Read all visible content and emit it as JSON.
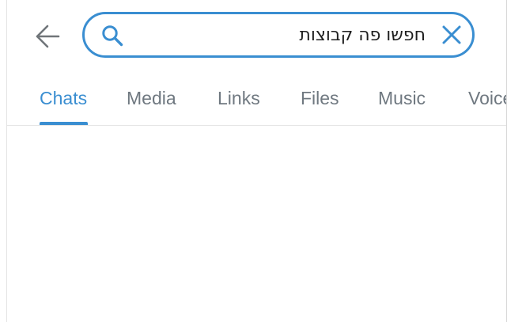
{
  "search": {
    "value": "חפשו פה קבוצות",
    "back_icon": "arrow-left-icon",
    "search_icon": "search-icon",
    "clear_icon": "close-icon"
  },
  "tabs": [
    {
      "label": "Chats",
      "active": true
    },
    {
      "label": "Media",
      "active": false
    },
    {
      "label": "Links",
      "active": false
    },
    {
      "label": "Files",
      "active": false
    },
    {
      "label": "Music",
      "active": false
    },
    {
      "label": "Voice",
      "active": false
    }
  ],
  "colors": {
    "accent": "#3a8ed1",
    "tab_inactive": "#6f7880",
    "icon_gray": "#707579",
    "divider": "#e5e5e5"
  }
}
